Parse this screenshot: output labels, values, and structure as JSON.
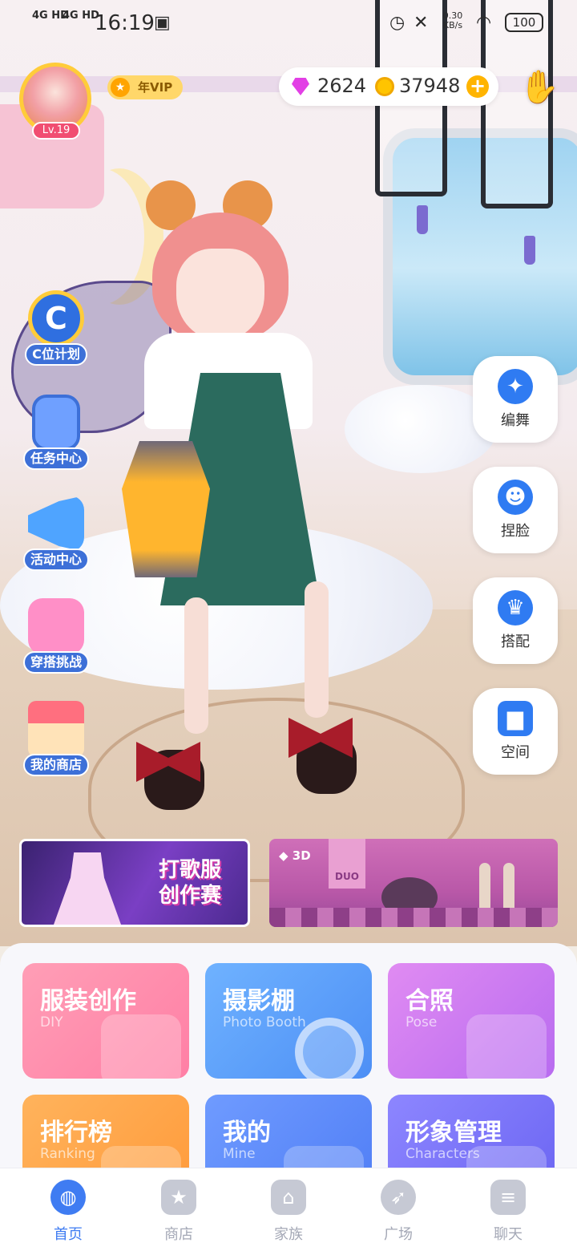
{
  "status_bar": {
    "signal_1": "4G HD",
    "signal_2": "4G HD",
    "time": "16:19",
    "net_speed": "0.30",
    "net_speed_unit": "KB/s",
    "battery": "100"
  },
  "profile": {
    "level": "Lv.19",
    "vip_label": "年VIP"
  },
  "currency": {
    "gems": "2624",
    "coins": "37948",
    "add_symbol": "+"
  },
  "left_menu": [
    {
      "label": "C位计划",
      "icon": "c-position-icon",
      "icon_glyph": "C"
    },
    {
      "label": "任务中心",
      "icon": "clipboard-icon"
    },
    {
      "label": "活动中心",
      "icon": "megaphone-icon"
    },
    {
      "label": "穿搭挑战",
      "icon": "outfit-challenge-icon"
    },
    {
      "label": "我的商店",
      "icon": "shop-icon"
    }
  ],
  "right_menu": [
    {
      "label": "编舞",
      "icon": "dance-icon",
      "glyph": "✦"
    },
    {
      "label": "捏脸",
      "icon": "face-edit-icon",
      "glyph": "☻"
    },
    {
      "label": "搭配",
      "icon": "dress-icon",
      "glyph": "♛"
    },
    {
      "label": "空间",
      "icon": "sofa-icon",
      "glyph": "▆"
    }
  ],
  "banners": {
    "left_title_line1": "打歌服",
    "left_title_line2": "创作赛",
    "right_tag": "3D",
    "right_sign": "DUO"
  },
  "cards": [
    {
      "title": "服装创作",
      "subtitle": "DIY",
      "color_start": "#ff9eb6",
      "color_end": "#ff7fa5"
    },
    {
      "title": "摄影棚",
      "subtitle": "Photo Booth",
      "color_start": "#6fb2ff",
      "color_end": "#4d8ff5"
    },
    {
      "title": "合照",
      "subtitle": "Pose",
      "color_start": "#e08bf2",
      "color_end": "#b86bf0"
    },
    {
      "title": "排行榜",
      "subtitle": "Ranking",
      "color_start": "#ffb35c",
      "color_end": "#ff9a3a"
    },
    {
      "title": "我的",
      "subtitle": "Mine",
      "color_start": "#6f9bff",
      "color_end": "#4f7df5"
    },
    {
      "title": "形象管理",
      "subtitle": "Characters",
      "color_start": "#8d86ff",
      "color_end": "#6a64f2"
    }
  ],
  "tabs": [
    {
      "label": "首页",
      "icon": "planet-icon",
      "glyph": "◍",
      "active": true
    },
    {
      "label": "商店",
      "icon": "shopping-bag-icon",
      "glyph": "★",
      "active": false
    },
    {
      "label": "家族",
      "icon": "home-icon",
      "glyph": "⌂",
      "active": false
    },
    {
      "label": "广场",
      "icon": "compass-icon",
      "glyph": "➶",
      "active": false
    },
    {
      "label": "聊天",
      "icon": "chat-icon",
      "glyph": "≡",
      "active": false
    }
  ],
  "colors": {
    "accent": "#3f7cf2",
    "vip_gold": "#ffd76a",
    "level_pink": "#f14e72",
    "left_label_blue": "#3d70d8"
  }
}
